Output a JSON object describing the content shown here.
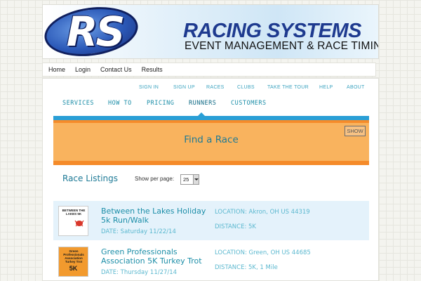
{
  "brand": {
    "logo_letters": "RS",
    "title": "RACING SYSTEMS",
    "tagline": "EVENT MANAGEMENT & RACE TIMING"
  },
  "main_nav": [
    {
      "label": "Home"
    },
    {
      "label": "Login"
    },
    {
      "label": "Contact Us"
    },
    {
      "label": "Results"
    }
  ],
  "top_links": [
    {
      "label": "SIGN IN"
    },
    {
      "label": "SIGN UP"
    },
    {
      "label": "RACES"
    },
    {
      "label": "CLUBS"
    },
    {
      "label": "TAKE THE TOUR"
    },
    {
      "label": "HELP"
    },
    {
      "label": "ABOUT"
    }
  ],
  "sub_nav": [
    {
      "label": "SERVICES"
    },
    {
      "label": "HOW TO"
    },
    {
      "label": "PRICING"
    },
    {
      "label": "RUNNERS",
      "active": true
    },
    {
      "label": "CUSTOMERS"
    }
  ],
  "hero": {
    "title": "Find a Race",
    "show_label": "SHOW"
  },
  "listings": {
    "title": "Race Listings",
    "per_page_label": "Show per page:",
    "per_page_value": "25"
  },
  "races": [
    {
      "name": "Between the Lakes Holiday 5k Run/Walk",
      "date": "DATE: Saturday 11/22/14",
      "location": "LOCATION: Akron, OH US 44319",
      "distance": "DISTANCE: 5K",
      "thumb_text": "BETWEEN THE LAKES 5K"
    },
    {
      "name": "Green Professionals Association 5K Turkey Trot",
      "date": "DATE: Thursday 11/27/14",
      "location": "LOCATION: Green, OH US 44685",
      "distance": "DISTANCE: 5K, 1 Mile",
      "thumb_text": "Green Professionals Association Turkey Trot",
      "thumb_big": "5K"
    }
  ],
  "colors": {
    "accent_teal": "#1c8ea8",
    "hero_orange": "#f9b35e",
    "hero_blue_bar": "#2a9fd6",
    "brand_navy": "#1e3a8f"
  }
}
